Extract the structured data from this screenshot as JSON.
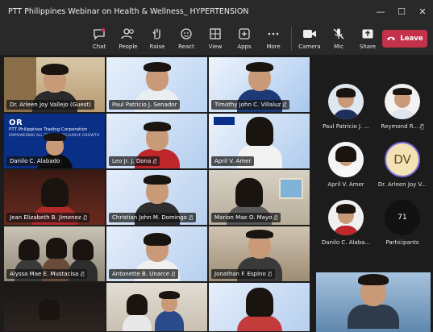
{
  "window": {
    "title": "PTT Philippines Webinar on Health & Wellness_ HYPERTENSION",
    "controls": [
      "—",
      "☐",
      "✕"
    ]
  },
  "toolbar": {
    "items": [
      {
        "label": "Chat",
        "icon": "chat-icon"
      },
      {
        "label": "People",
        "icon": "people-icon"
      },
      {
        "label": "Raise",
        "icon": "raise-hand-icon"
      },
      {
        "label": "React",
        "icon": "react-icon"
      },
      {
        "label": "View",
        "icon": "view-grid-icon"
      },
      {
        "label": "Apps",
        "icon": "apps-icon"
      },
      {
        "label": "More",
        "icon": "more-icon"
      }
    ],
    "media": [
      {
        "label": "Camera",
        "icon": "camera-icon"
      },
      {
        "label": "Mic",
        "icon": "mic-muted-icon"
      },
      {
        "label": "Share",
        "icon": "share-icon"
      }
    ],
    "leave_label": "Leave",
    "leave_color": "#c4314b"
  },
  "tiles": [
    {
      "name": "Dr. Arleen Joy Vallejo (Guest)",
      "mic": false
    },
    {
      "name": "Paul Patricio J. Senador",
      "mic": false
    },
    {
      "name": "Timothy John C. Villaluz",
      "mic": true
    },
    {
      "name": "Danilo C. Alabado",
      "mic": false
    },
    {
      "name": "Leo Jr. J. Dona",
      "mic": true
    },
    {
      "name": "April V. Amer",
      "mic": false
    },
    {
      "name": "Jean Elizabeth B. Jimenez",
      "mic": true
    },
    {
      "name": "Christian John M. Domingo",
      "mic": true
    },
    {
      "name": "Marion Mae O. Mayo",
      "mic": true
    },
    {
      "name": "Alyssa Mae E. Mustacisa",
      "mic": true
    },
    {
      "name": "Antonette B. Unarce",
      "mic": true
    },
    {
      "name": "Jonathan F. Espino",
      "mic": true
    }
  ],
  "banner": {
    "logo": "OR",
    "company": "PTT Philippines Trading Corporation",
    "tagline": "EMPOWERING ALL TOWARD INCLUSIVE GROWTH"
  },
  "side_panel": {
    "participants": [
      {
        "name": "Paul Patricio J. ...",
        "mic": false
      },
      {
        "name": "Reymond R...",
        "mic": true
      },
      {
        "name": "April V. Amer",
        "mic": false
      },
      {
        "name": "Dr. Arleen Joy V...",
        "initials": "DV",
        "mic": false
      },
      {
        "name": "Danilo C. Alaba...",
        "mic": false
      }
    ],
    "count": "71",
    "count_label": "Participants"
  }
}
